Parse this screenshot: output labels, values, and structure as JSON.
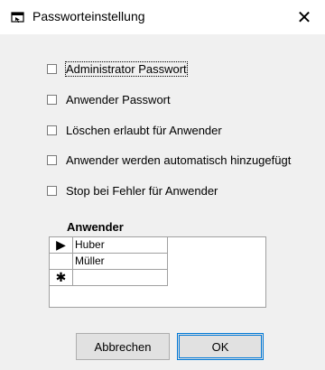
{
  "window": {
    "title": "Passworteinstellung",
    "close_glyph": "✕",
    "icon": "key-window-icon"
  },
  "options": [
    {
      "label": "Administrator Passwort",
      "checked": false
    },
    {
      "label": "Anwender Passwort",
      "checked": false
    },
    {
      "label": "Löschen erlaubt für Anwender",
      "checked": false
    },
    {
      "label": "Anwender werden automatisch hinzugefügt",
      "checked": false
    },
    {
      "label": "Stop bei Fehler für Anwender",
      "checked": false
    }
  ],
  "grid": {
    "title": "Anwender",
    "rows": [
      {
        "marker": "▶",
        "value": "Huber"
      },
      {
        "marker": "",
        "value": "Müller"
      },
      {
        "marker": "✱",
        "value": ""
      }
    ]
  },
  "buttons": {
    "cancel": "Abbrechen",
    "ok": "OK"
  }
}
